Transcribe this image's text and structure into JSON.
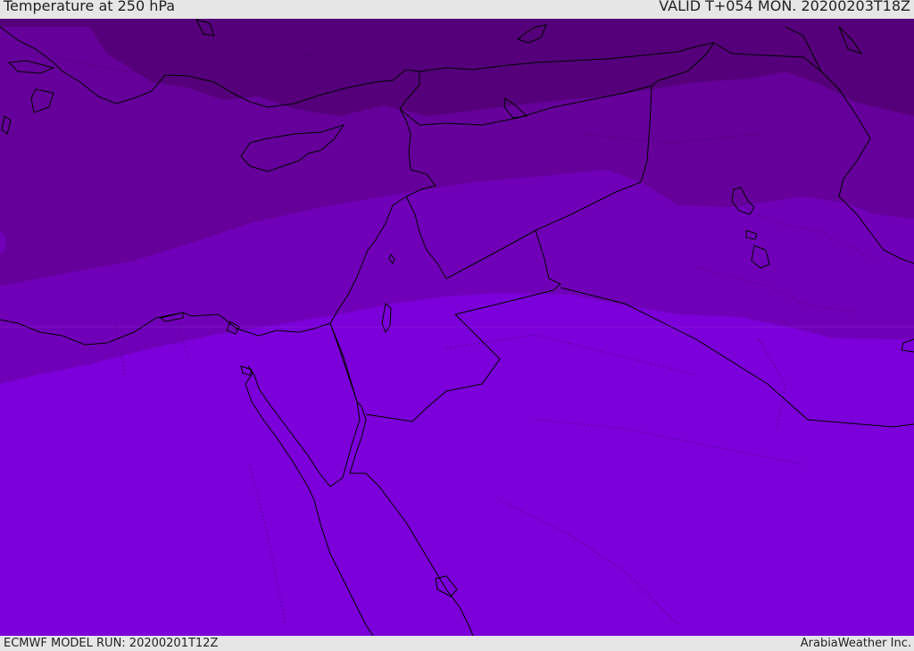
{
  "header": {
    "title": "Temperature at 250 hPa",
    "valid": "VALID T+054 MON. 20200203T18Z"
  },
  "footer": {
    "model_run": "ECMWF MODEL RUN: 20200201T12Z",
    "credit": "ArabiaWeather Inc."
  },
  "colors": {
    "band_darkest": "#55007a",
    "band_dark": "#65009a",
    "band_mid": "#7000b8",
    "band_light": "#7b00d9",
    "coastline": "#000000",
    "border": "#000000"
  }
}
